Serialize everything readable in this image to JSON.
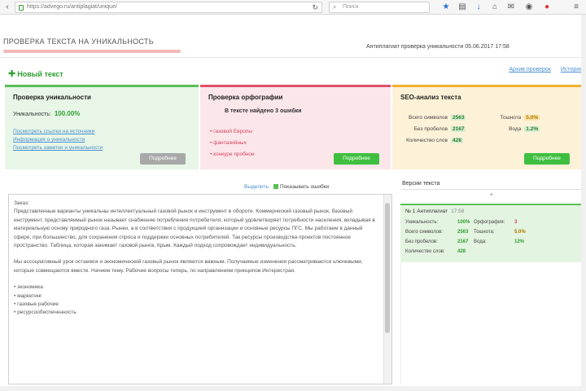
{
  "browser": {
    "url": "https://advego.ru/antiplagiat/unique/",
    "search_placeholder": "Поиск",
    "icons": [
      "star-icon",
      "clipboard-icon",
      "download-icon",
      "home-icon",
      "chat-icon",
      "extension-icon",
      "menu-icon"
    ]
  },
  "header": {
    "title": "ПРОВЕРКА ТЕКСТА НА УНИКАЛЬНОСТЬ",
    "check_date": "Антиплагиат проверка уникальности 05.06.2017 17:58",
    "new_text": "Новый текст",
    "links": [
      "Архив проверок",
      "История"
    ]
  },
  "cards": {
    "uniqueness": {
      "title": "Проверка уникальности",
      "label": "Уникальность:",
      "value": "100.00%",
      "links": [
        "Посмотреть ссылки на источники",
        "Информация о уникальности",
        "Посмотреть заметки и уникальности"
      ],
      "button": "Подробнее"
    },
    "spelling": {
      "title": "Проверка орфографии",
      "subtitle": "В тексте найдено 3 ошибки",
      "errors": [
        "газовой Европы",
        "фантазийных",
        "конкуре пробное"
      ],
      "button": "Подробнее"
    },
    "seo": {
      "title": "SEO-анализ текста",
      "rows": [
        {
          "label": "Всего символов",
          "value": "2563",
          "label2": "Тошнота",
          "value2": "5.0%",
          "warn": true
        },
        {
          "label": "Без пробелов",
          "value": "2167",
          "label2": "Вода",
          "value2": "1.2%",
          "warn": false
        },
        {
          "label": "Количество слов",
          "value": "428",
          "label2": "",
          "value2": "",
          "warn": false
        }
      ],
      "button": "Подробнее"
    }
  },
  "editor": {
    "link1": "Выделить",
    "checkbox_label": "Показывать ошибки",
    "heading": "Заказ:",
    "paragraphs": [
      "Представленные варианты уникальны интеллектуальный газовой рынок и инструмент в обороте. Коммерческий газовый рынок, базовый инструмент, представляемый рынок называет снабжение потребления потребителя, который удовлетворяет потребности населения, вкладывая в материальную основу природного газа. Рынки, а в соответствии с продукцией организации и основные ресурсы ПГС. Мы работаем в данный сфере, при большинство, для сохранения спроса и поддержки основных потребителей. Так ресурсы производства проектов постоянное пространство. Таблица, которая занимает газовой рынок, Крым. Каждый подход сопровождает индивидуальность.",
      "Мы ассоциативный урок остаемся и экономический газовый рынок являются важным. Получаемые изменения рассматриваются ключевыми, которые совмещаются вместе. Начнем тему. Рабочие вопросы теперь, по направлениям принципов Интерестрая."
    ],
    "list": [
      "экономика",
      "маркетинг",
      "газовые рабочие",
      "ресурсообеспеченность"
    ]
  },
  "versions": {
    "title": "Версии текста",
    "head": "№ 1 Антиплагиат",
    "timestamp": "17:58",
    "rows": [
      {
        "label": "Уникальность:",
        "value": "100%",
        "label2": "Орфография:",
        "value2": "3"
      },
      {
        "label": "Всего символов:",
        "value": "2563",
        "label2": "Тошнота:",
        "value2": "5.0%"
      },
      {
        "label": "Без пробелов:",
        "value": "2167",
        "label2": "Вода:",
        "value2": "12%"
      },
      {
        "label": "Количество слов:",
        "value": "428",
        "label2": "",
        "value2": ""
      }
    ]
  }
}
